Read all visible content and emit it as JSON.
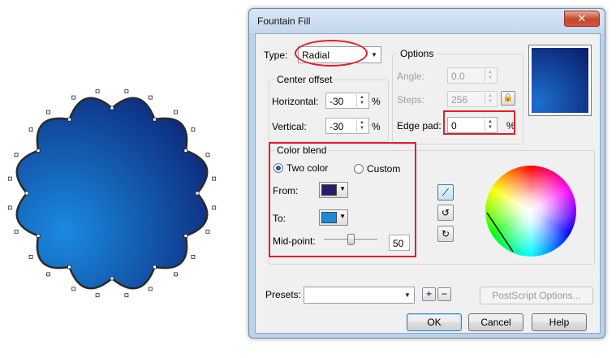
{
  "window": {
    "title": "Fountain Fill",
    "close_glyph": "✕"
  },
  "type": {
    "label": "Type:",
    "value": "Radial"
  },
  "options": {
    "title": "Options",
    "angle_label": "Angle:",
    "angle_value": "0.0",
    "steps_label": "Steps:",
    "steps_value": "256",
    "edge_pad_label": "Edge pad:",
    "edge_pad_value": "0",
    "edge_pad_unit": "%"
  },
  "center_offset": {
    "title": "Center offset",
    "horizontal_label": "Horizontal:",
    "horizontal_value": "-30",
    "horizontal_unit": "%",
    "vertical_label": "Vertical:",
    "vertical_value": "-30",
    "vertical_unit": "%"
  },
  "color_blend": {
    "title": "Color blend",
    "two_color_label": "Two color",
    "custom_label": "Custom",
    "from_label": "From:",
    "from_color": "#2a1a6e",
    "to_label": "To:",
    "to_color": "#1a8ae0",
    "midpoint_label": "Mid-point:",
    "midpoint_value": "50"
  },
  "presets": {
    "label": "Presets:",
    "value": ""
  },
  "buttons": {
    "postscript": "PostScript Options...",
    "ok": "OK",
    "cancel": "Cancel",
    "help": "Help"
  },
  "colors": {
    "accent_red": "#e0202a",
    "preview_start": "#0a1f6e",
    "preview_end": "#1e6fd0"
  }
}
